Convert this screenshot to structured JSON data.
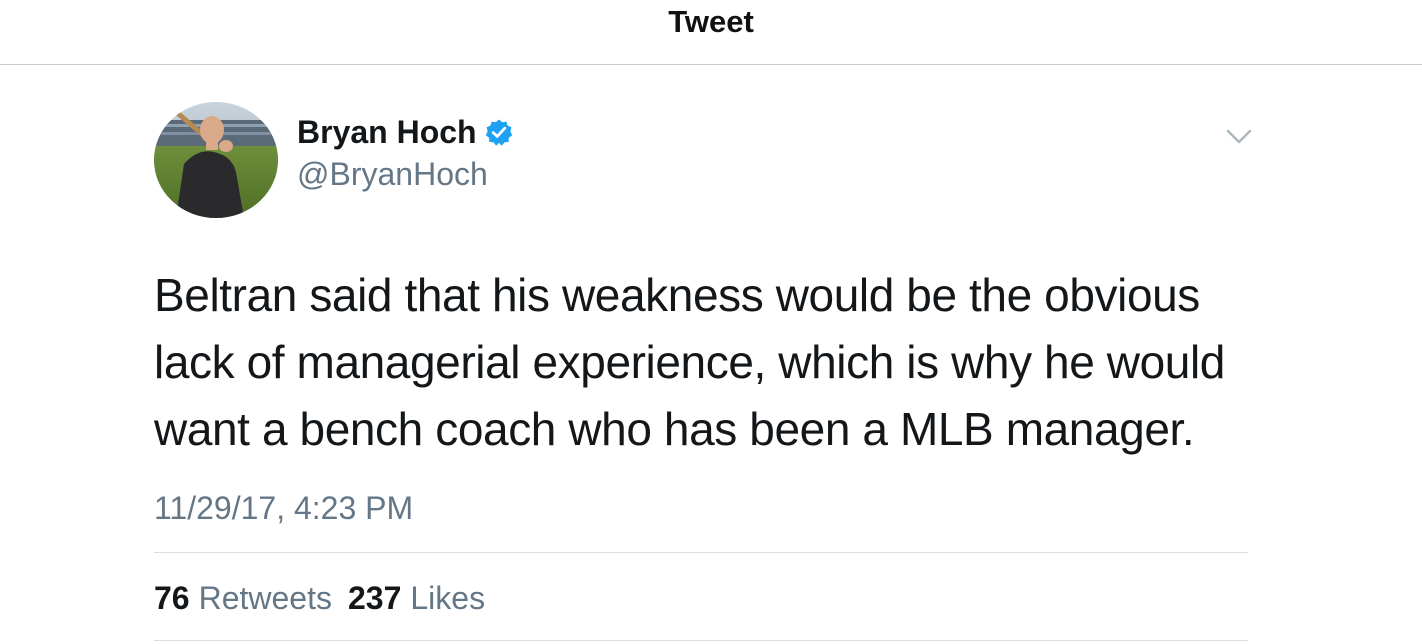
{
  "header": {
    "title": "Tweet"
  },
  "tweet": {
    "author": {
      "name": "Bryan Hoch",
      "handle": "@BryanHoch",
      "verified": true,
      "verified_icon": "verified-badge-icon",
      "avatar_icon": "avatar-photo"
    },
    "menu_icon": "chevron-down-icon",
    "text": "Beltran said that his weakness would be the obvious lack of managerial experience, which is why he would want a bench coach who has been a MLB manager.",
    "timestamp": "11/29/17, 4:23 PM",
    "stats": {
      "retweets_count": "76",
      "retweets_label": "Retweets",
      "likes_count": "237",
      "likes_label": "Likes"
    }
  },
  "colors": {
    "text_primary": "#14171a",
    "text_secondary": "#657786",
    "verified_blue": "#1da1f2",
    "divider": "#d8dde1"
  }
}
